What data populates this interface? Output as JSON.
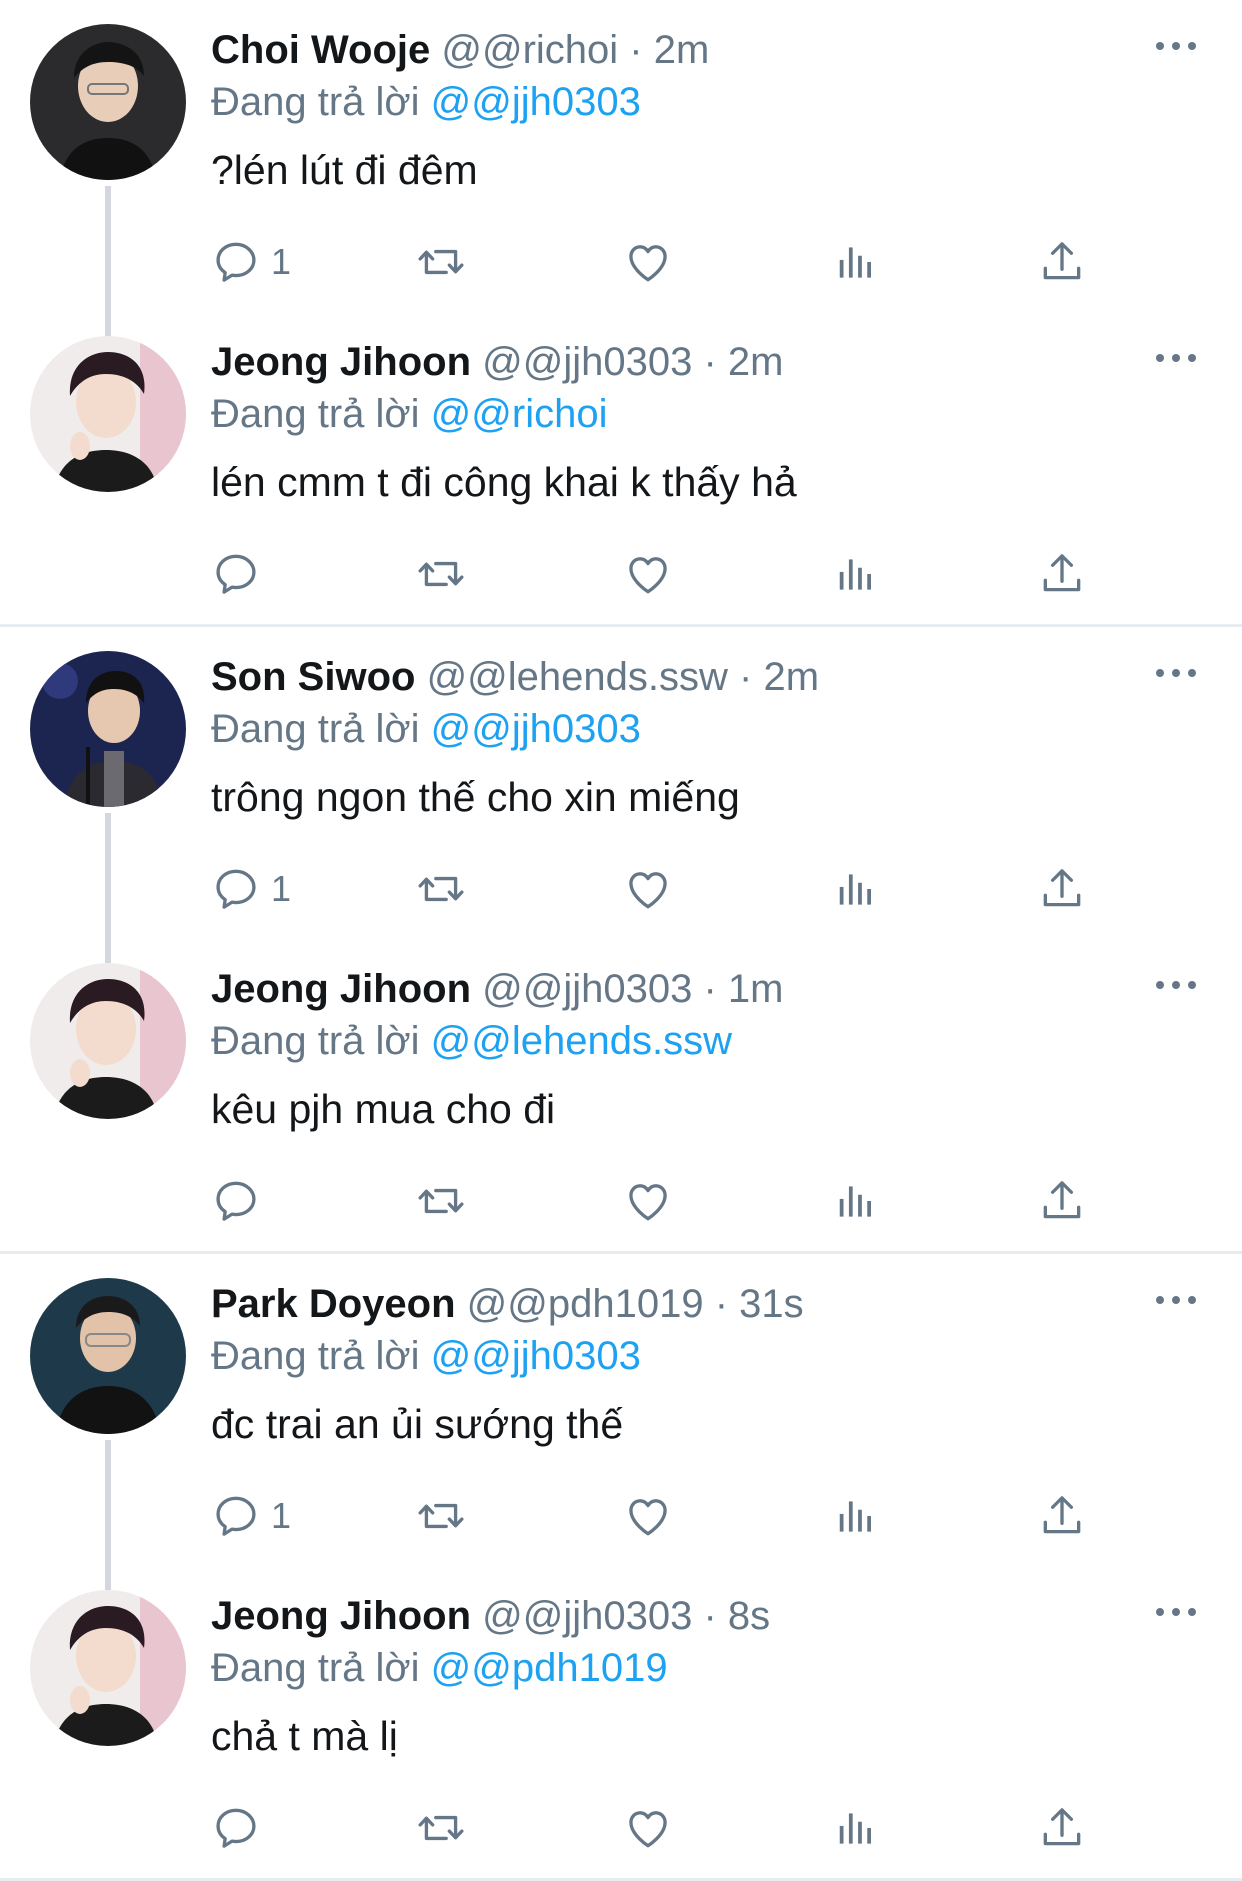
{
  "tweets": [
    {
      "name": "Choi Wooje",
      "handle": "@@richoi",
      "time": "2m",
      "reply_label": "Đang trả lời",
      "reply_to": "@@jjh0303",
      "text": "?lén lút đi đêm",
      "replies": "1"
    },
    {
      "name": "Jeong Jihoon",
      "handle": "@@jjh0303",
      "time": "2m",
      "reply_label": "Đang trả lời",
      "reply_to": "@@richoi",
      "text": "lén cmm t đi công khai k thấy hả",
      "replies": ""
    },
    {
      "name": "Son Siwoo",
      "handle": "@@lehends.ssw",
      "time": "2m",
      "reply_label": "Đang trả lời",
      "reply_to": "@@jjh0303",
      "text": "trông ngon thế cho xin miếng",
      "replies": "1"
    },
    {
      "name": "Jeong Jihoon",
      "handle": "@@jjh0303",
      "time": "1m",
      "reply_label": "Đang trả lời",
      "reply_to": "@@lehends.ssw",
      "text": "kêu pjh mua cho đi",
      "replies": ""
    },
    {
      "name": "Park Doyeon",
      "handle": "@@pdh1019",
      "time": "31s",
      "reply_label": "Đang trả lời",
      "reply_to": "@@jjh0303",
      "text": "đc trai an ủi sướng thế",
      "replies": "1"
    },
    {
      "name": "Jeong Jihoon",
      "handle": "@@jjh0303",
      "time": "8s",
      "reply_label": "Đang trả lời",
      "reply_to": "@@pdh1019",
      "text": "chả t mà lị",
      "replies": ""
    }
  ],
  "separator": "·",
  "icons": {
    "reply": "reply-icon",
    "retweet": "retweet-icon",
    "like": "heart-icon",
    "stats": "stats-icon",
    "share": "share-icon",
    "more": "more-icon"
  },
  "colors": {
    "accent": "#1da1f2",
    "muted": "#657786",
    "text": "#14171a",
    "divider": "#e6ecf0"
  }
}
